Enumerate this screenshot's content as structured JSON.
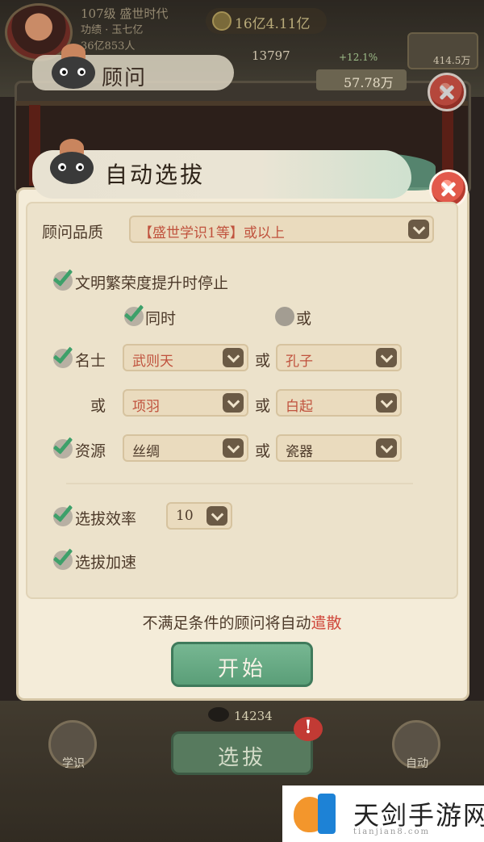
{
  "background": {
    "player_name": "107级 盛世时代",
    "player_sub": "功绩 · 玉七亿",
    "player_sub2": "36亿853人",
    "gold": "16亿4.11亿",
    "stat_center": "13797",
    "stat_plus": "+12.1%",
    "stat_right": "414.5万",
    "money": "57.78万",
    "panel_title": "顾问"
  },
  "dialog": {
    "title": "自动选拔",
    "quality_label": "顾问品质",
    "quality_value": "【盛世学识1等】或以上",
    "stop_label": "文明繁荣度提升时停止",
    "same_time_label": "同时",
    "or_label": "或",
    "famous_label": "名士",
    "famous_1": "武则天",
    "famous_2": "孔子",
    "famous_3": "项羽",
    "famous_4": "白起",
    "resource_label": "资源",
    "resource_1": "丝绸",
    "resource_2": "瓷器",
    "efficiency_label": "选拔效率",
    "efficiency_value": "10",
    "speedup_label": "选拔加速",
    "notice_prefix": "不满足条件的顾问将自动",
    "notice_warn": "遣散",
    "start_label": "开始"
  },
  "bottom": {
    "count": "14234",
    "select_label": "选拔",
    "left_btn": "学识",
    "right_btn": "自动",
    "badge": "!"
  },
  "watermark": {
    "text": "天剑手游网",
    "sub": "tianjian8.com"
  },
  "colors": {
    "accent_green": "#5a9e78",
    "warn_red": "#d0483c",
    "select_text": "#c0523d",
    "panel_bg": "#f4ecd9"
  }
}
